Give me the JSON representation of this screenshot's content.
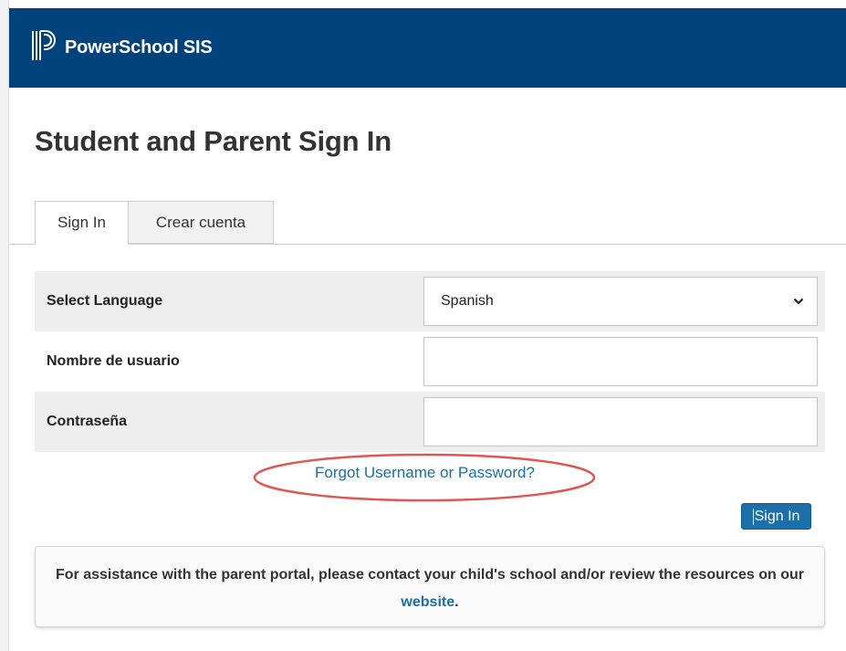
{
  "header": {
    "brand": "PowerSchool SIS",
    "background_color": "#00427c",
    "logo_icon": "powerschool-logo"
  },
  "page": {
    "title": "Student and Parent Sign In"
  },
  "tabs": [
    {
      "label": "Sign In",
      "active": true
    },
    {
      "label": "Crear cuenta",
      "active": false
    }
  ],
  "form": {
    "language": {
      "label": "Select Language",
      "selected": "Spanish"
    },
    "username": {
      "label": "Nombre de usuario",
      "value": ""
    },
    "password": {
      "label": "Contraseña",
      "value": ""
    }
  },
  "links": {
    "forgot": "Forgot Username or Password?",
    "forgot_color": "#1a6fa8"
  },
  "annotation": {
    "highlight_color": "#e05555"
  },
  "buttons": {
    "sign_in": "Sign In",
    "sign_in_color": "#1b70ac"
  },
  "assistance": {
    "text_before": "For assistance with the parent portal, please contact your child's school and/or review the resources on our ",
    "link_text": "website",
    "text_after": "."
  }
}
